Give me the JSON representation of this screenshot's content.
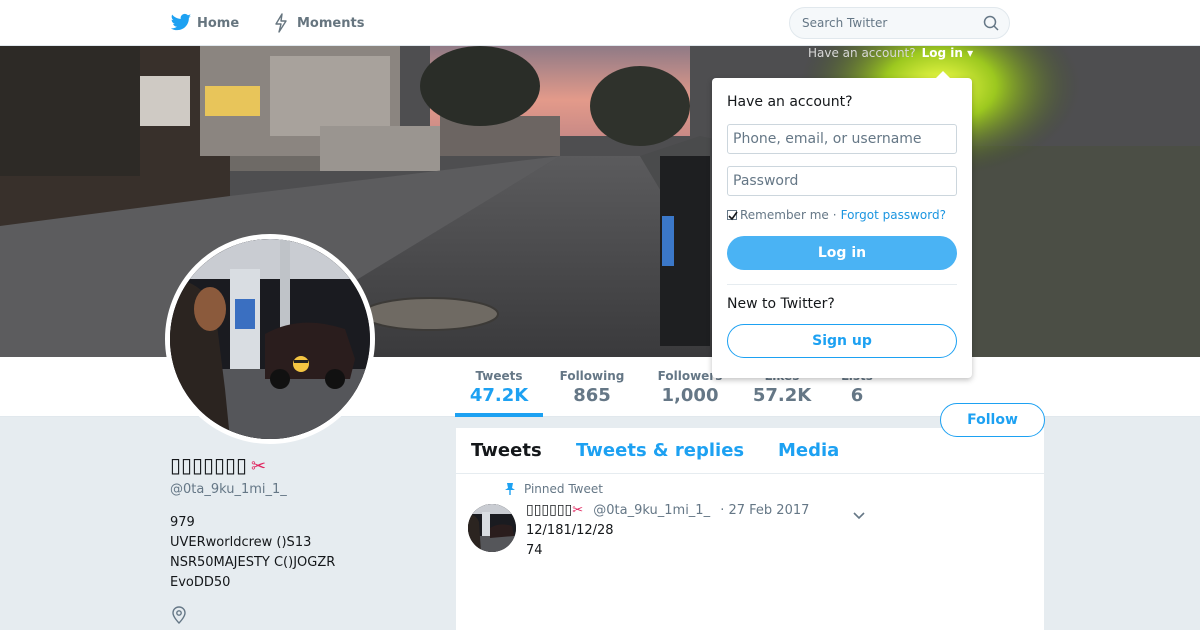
{
  "nav": {
    "home_label": "Home",
    "moments_label": "Moments",
    "search_placeholder": "Search Twitter",
    "account_prompt": "Have an account?",
    "login_label": "Log in ▾"
  },
  "profile": {
    "display_name": "▯▯▯▯▯▯▯",
    "name_emoji": "✂",
    "handle": "@0ta_9ku_1mi_1_",
    "bio_lines": [
      "979",
      "UVERworldcrew ()S13",
      "NSR50MAJESTY C()JOGZR",
      "EvoDD50"
    ]
  },
  "stats": [
    {
      "label": "Tweets",
      "value": "47.2K"
    },
    {
      "label": "Following",
      "value": "865"
    },
    {
      "label": "Followers",
      "value": "1,000"
    },
    {
      "label": "Likes",
      "value": "57.2K"
    },
    {
      "label": "Lists",
      "value": "6"
    }
  ],
  "follow_label": "Follow",
  "timeline": {
    "tabs": [
      "Tweets",
      "Tweets & replies",
      "Media"
    ],
    "pinned_label": "Pinned Tweet",
    "tweet": {
      "author": "▯▯▯▯▯▯",
      "author_emoji": "✂",
      "handle": "@0ta_9ku_1mi_1_",
      "date": "· 27 Feb 2017",
      "lines": [
        "12/181/12/28",
        "74"
      ]
    }
  },
  "login_dropdown": {
    "heading": "Have an account?",
    "username_placeholder": "Phone, email, or username",
    "password_placeholder": "Password",
    "remember_label": "Remember me",
    "separator": "·",
    "forgot_label": "Forgot password?",
    "login_button": "Log in",
    "new_heading": "New to Twitter?",
    "signup_button": "Sign up"
  },
  "colors": {
    "accent": "#1da1f2",
    "background": "#e6ecf0"
  },
  "icons": [
    "twitter-bird-icon",
    "moments-bolt-icon",
    "search-icon",
    "pin-icon",
    "location-icon",
    "chevron-down-icon"
  ]
}
